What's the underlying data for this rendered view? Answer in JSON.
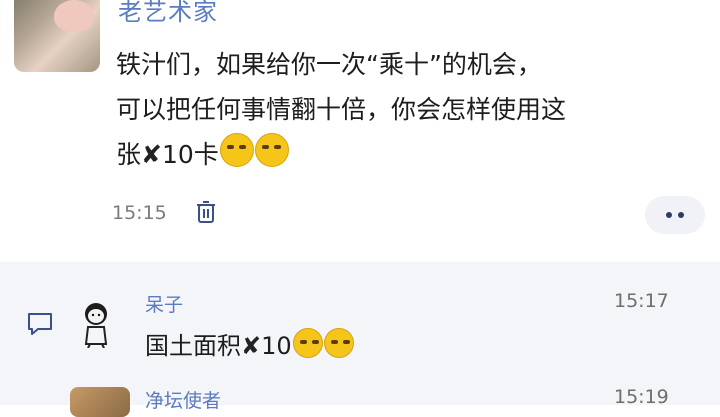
{
  "post": {
    "author": "老艺术家",
    "content_line1": "铁汁们，如果给你一次“乘十”的机会，",
    "content_line2": "可以把任何事情翻十倍，你会怎样使用这",
    "content_line3_prefix": "张",
    "content_line3_mark": "✘",
    "content_line3_suffix": "10卡",
    "time": "15:15",
    "emoji_count": 2
  },
  "comments": [
    {
      "name": "呆子",
      "time": "15:17",
      "text_prefix": "国土面积",
      "text_mark": "✘",
      "text_suffix": "10"
    },
    {
      "name": "净坛使者",
      "time": "15:19"
    }
  ],
  "icons": {
    "delete": "trash-icon",
    "more": "more-dots-icon",
    "comment": "comment-icon"
  },
  "colors": {
    "name_blue": "#5b7cc0",
    "text": "#1d1d1d",
    "time_gray": "#7b7b7b",
    "comment_bg": "#f4f5f9"
  }
}
